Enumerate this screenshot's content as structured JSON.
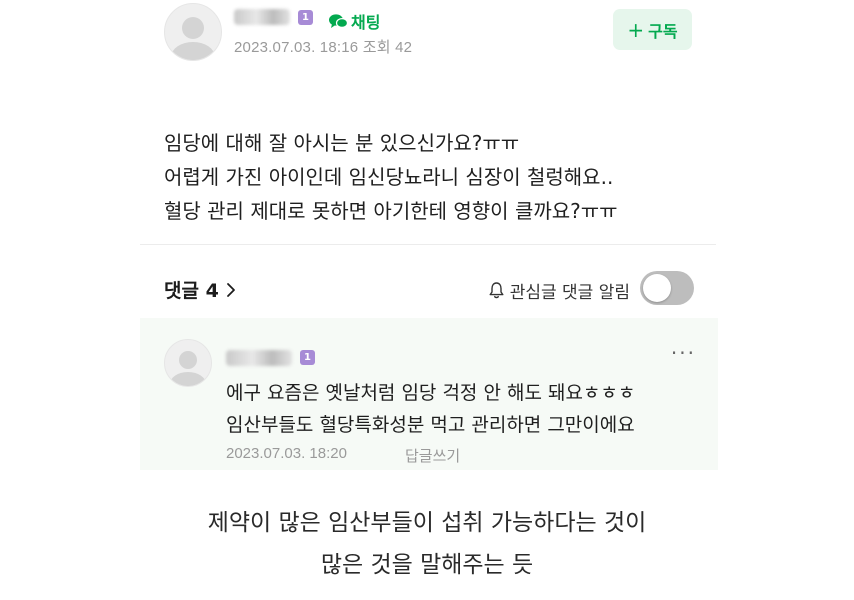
{
  "post": {
    "chat_label": "채팅",
    "level_badge": "1",
    "date": "2023.07.03. 18:16",
    "views": "조회 42",
    "subscribe_label": "구독",
    "subscribe_plus": "+",
    "body_lines": [
      "임당에 대해 잘 아시는 분 있으신가요?ㅠㅠ",
      "어렵게 가진 아이인데 임신당뇨라니 심장이 철렁해요..",
      "혈당 관리 제대로 못하면 아기한테 영향이 클까요?ㅠㅠ"
    ]
  },
  "comments_bar": {
    "title": "댓글 4",
    "notify_label": "관심글 댓글 알림",
    "toggle_on": false
  },
  "comment": {
    "level_badge": "1",
    "lines": [
      "에구 요즘은 옛날처럼 임당 걱정 안 해도 돼요ㅎㅎㅎ",
      "임산부들도 혈당특화성분 먹고 관리하면 그만이에요"
    ],
    "date": "2023.07.03. 18:20",
    "reply_label": "답글쓰기",
    "more_dots": "···"
  },
  "caption": {
    "lines": [
      "제약이 많은 임산부들이 섭취 가능하다는 것이",
      "많은 것을 말해주는 듯"
    ]
  },
  "colors": {
    "accent_green": "#03a94f",
    "subscribe_bg": "#e6f6ec",
    "comment_bg": "#f6faf6",
    "level_badge": "#a78bd6"
  }
}
